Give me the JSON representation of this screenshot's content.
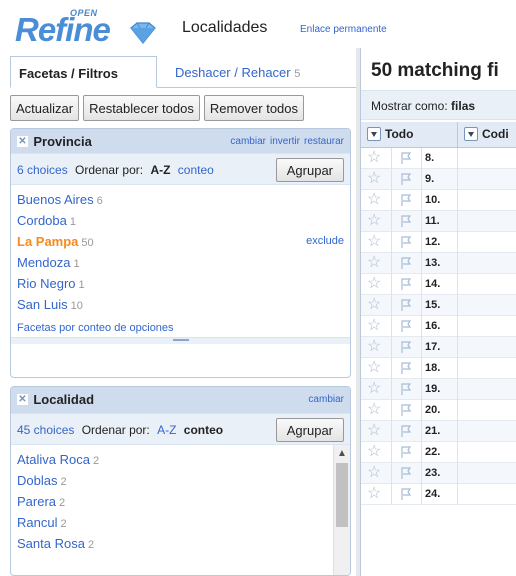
{
  "header": {
    "logo_open": "OPEN",
    "logo_text": "Refine",
    "project_name": "Localidades",
    "permalink": "Enlace permanente"
  },
  "left_panel": {
    "tabs": [
      {
        "label": "Facetas / Filtros"
      },
      {
        "label": "Deshacer / Rehacer",
        "count": "5"
      }
    ],
    "buttons": {
      "refresh": "Actualizar",
      "reset_all": "Restablecer todos",
      "remove_all": "Remover todos"
    },
    "facets": [
      {
        "title": "Provincia",
        "links": [
          "cambiar",
          "invertir",
          "restaurar"
        ],
        "choices_count": "6 choices",
        "sort_label": "Ordenar por:",
        "sort_az": "A-Z",
        "sort_count": "conteo",
        "group_button": "Agrupar",
        "choices": [
          {
            "name": "Buenos Aires",
            "count": "6"
          },
          {
            "name": "Cordoba",
            "count": "1"
          },
          {
            "name": "La Pampa",
            "count": "50",
            "selected": true,
            "action": "exclude"
          },
          {
            "name": "Mendoza",
            "count": "1"
          },
          {
            "name": "Rio Negro",
            "count": "1"
          },
          {
            "name": "San Luis",
            "count": "10"
          }
        ],
        "footer": "Facetas por conteo de opciones"
      },
      {
        "title": "Localidad",
        "links": [
          "cambiar"
        ],
        "choices_count": "45 choices",
        "sort_label": "Ordenar por:",
        "sort_az": "A-Z",
        "sort_count": "conteo",
        "group_button": "Agrupar",
        "choices": [
          {
            "name": "Ataliva Roca",
            "count": "2"
          },
          {
            "name": "Doblas",
            "count": "2"
          },
          {
            "name": "Parera",
            "count": "2"
          },
          {
            "name": "Rancul",
            "count": "2"
          },
          {
            "name": "Santa Rosa",
            "count": "2"
          }
        ]
      }
    ]
  },
  "right_panel": {
    "summary": "50 matching fi",
    "show_as_label": "Mostrar como:",
    "show_as_value": "filas",
    "columns": [
      "Todo",
      "Codi"
    ],
    "row_numbers": [
      "8.",
      "9.",
      "10.",
      "11.",
      "12.",
      "13.",
      "14.",
      "15.",
      "16.",
      "17.",
      "18.",
      "19.",
      "20.",
      "21.",
      "22.",
      "23.",
      "24."
    ]
  },
  "colors": {
    "accent_blue": "#3366cc",
    "selected_orange": "#f58a1f",
    "facet_header_bg": "#cfdced"
  }
}
